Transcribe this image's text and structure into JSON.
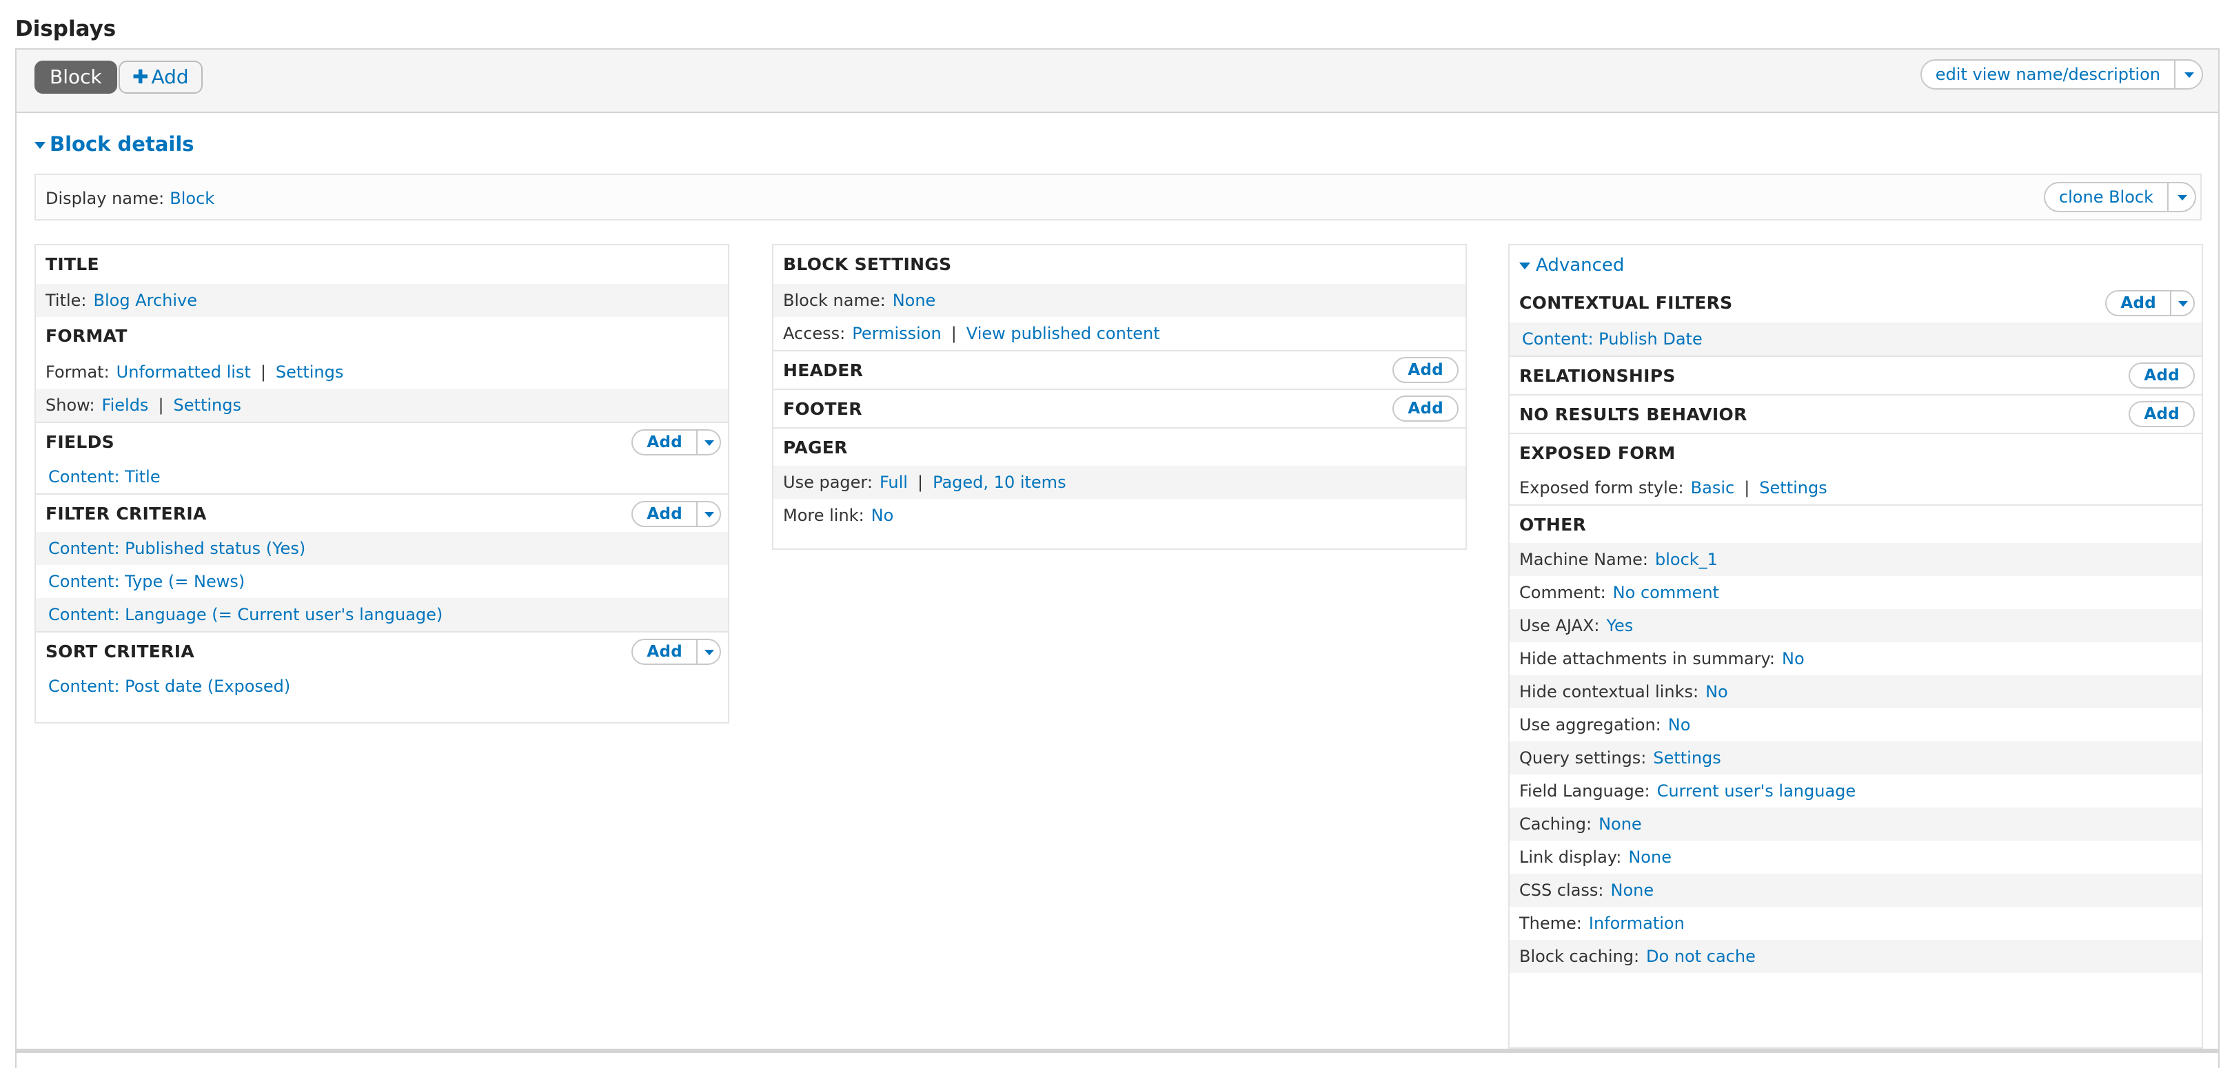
{
  "header": {
    "title": "Displays"
  },
  "tabs": {
    "block_label": "Block",
    "add_label": "Add"
  },
  "edit_view_label": "edit view name/description",
  "block_details": {
    "toggle_label": "Block details",
    "display_name_label": "Display name:",
    "display_name_value": "Block",
    "clone_label": "clone Block"
  },
  "left": {
    "title_head": "TITLE",
    "title_label": "Title:",
    "title_value": "Blog Archive",
    "format_head": "FORMAT",
    "format_label": "Format:",
    "format_value": "Unformatted list",
    "format_settings": "Settings",
    "show_label": "Show:",
    "show_value": "Fields",
    "show_settings": "Settings",
    "fields_head": "FIELDS",
    "fields_items": [
      "Content: Title"
    ],
    "filter_head": "FILTER CRITERIA",
    "filter_items": [
      "Content: Published status (Yes)",
      "Content: Type (= News)",
      "Content: Language (= Current user's language)"
    ],
    "sort_head": "SORT CRITERIA",
    "sort_items": [
      "Content: Post date (Exposed)"
    ],
    "add_label": "Add"
  },
  "middle": {
    "block_settings_head": "BLOCK SETTINGS",
    "block_name_label": "Block name:",
    "block_name_value": "None",
    "access_label": "Access:",
    "access_value": "Permission",
    "access_detail": "View published content",
    "header_head": "HEADER",
    "footer_head": "FOOTER",
    "pager_head": "PAGER",
    "use_pager_label": "Use pager:",
    "use_pager_value": "Full",
    "use_pager_detail": "Paged, 10 items",
    "more_link_label": "More link:",
    "more_link_value": "No",
    "add_label": "Add"
  },
  "right": {
    "advanced_label": "Advanced",
    "contextual_head": "CONTEXTUAL FILTERS",
    "contextual_items": [
      "Content: Publish Date"
    ],
    "relationships_head": "RELATIONSHIPS",
    "no_results_head": "NO RESULTS BEHAVIOR",
    "exposed_head": "EXPOSED FORM",
    "exposed_label": "Exposed form style:",
    "exposed_value": "Basic",
    "exposed_settings": "Settings",
    "other_head": "OTHER",
    "other_rows": [
      {
        "label": "Machine Name:",
        "value": "block_1"
      },
      {
        "label": "Comment:",
        "value": "No comment"
      },
      {
        "label": "Use AJAX:",
        "value": "Yes"
      },
      {
        "label": "Hide attachments in summary:",
        "value": "No"
      },
      {
        "label": "Hide contextual links:",
        "value": "No"
      },
      {
        "label": "Use aggregation:",
        "value": "No"
      },
      {
        "label": "Query settings:",
        "value": "Settings"
      },
      {
        "label": "Field Language:",
        "value": "Current user's language"
      },
      {
        "label": "Caching:",
        "value": "None"
      },
      {
        "label": "Link display:",
        "value": "None"
      },
      {
        "label": "CSS class:",
        "value": "None"
      },
      {
        "label": "Theme:",
        "value": "Information"
      },
      {
        "label": "Block caching:",
        "value": "Do not cache"
      }
    ],
    "add_label": "Add"
  },
  "colors": {
    "link": "#0074bd",
    "tab_active_bg": "#666666",
    "border": "#d4d4d4"
  },
  "icons": {
    "add_tab": "plus-icon",
    "dropdown": "caret-down-icon",
    "collapse": "triangle-down-icon"
  }
}
